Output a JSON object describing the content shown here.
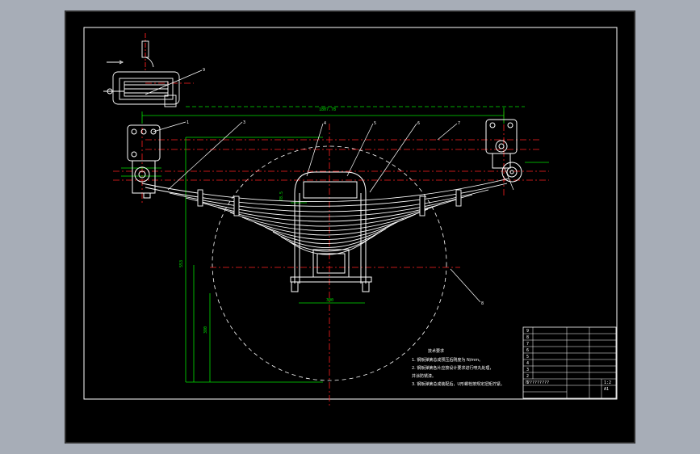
{
  "colors": {
    "background_gray": "#a7adb7",
    "sheet": "#000000",
    "border": "#ffffff",
    "centerline": "#ff2020",
    "dimension": "#00e000",
    "hidden_circle": "#ffffff"
  },
  "dimensions": {
    "overall_length": "1807.78",
    "height_total": "553",
    "height_lower": "380",
    "bracket_width": "300",
    "small_offset": "78.5"
  },
  "balloons": [
    "1",
    "3",
    "4",
    "5",
    "6",
    "7",
    "8",
    "9"
  ],
  "tech_notes": {
    "title": "技术要求",
    "lines": [
      "1. 钢板弹簧总成预压后刚度为 N/mm。",
      "2. 钢板弹簧各片应按设计要求进行喷丸处理，",
      "   并涂防锈漆。",
      "3. 钢板弹簧总成装配后，U形螺栓按规定扭矩拧紧。"
    ]
  },
  "title_block": {
    "drawing_name": "??????????",
    "scale": "1:2",
    "sheet_size": "A1",
    "rows": [
      "9",
      "8",
      "7",
      "6",
      "5",
      "4",
      "3",
      "2",
      "1"
    ]
  }
}
